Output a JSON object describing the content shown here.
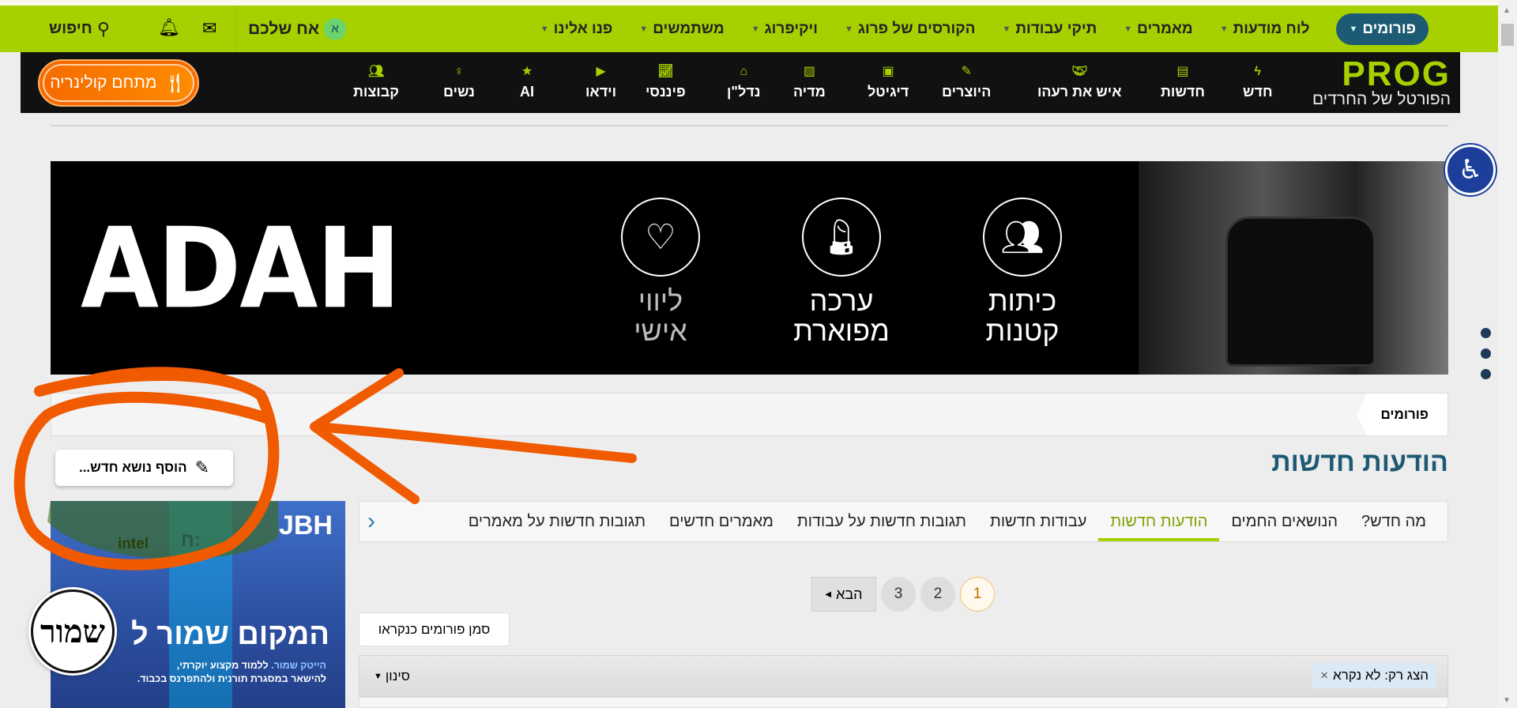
{
  "topnav": {
    "items": [
      {
        "label": "פורומים",
        "active": true
      },
      {
        "label": "לוח מודעות"
      },
      {
        "label": "מאמרים"
      },
      {
        "label": "תיקי עבודות"
      },
      {
        "label": "הקורסים של פרוג"
      },
      {
        "label": "ויקיפרוג"
      },
      {
        "label": "משתמשים"
      },
      {
        "label": "פנו אלינו"
      }
    ],
    "user_initial": "א",
    "user_name": "אח שלכם",
    "search_label": "חיפוש",
    "icons": [
      "envelope-icon",
      "bell-icon",
      "search-icon"
    ]
  },
  "logo": {
    "text": "PROG",
    "tagline": "הפורטל של החרדים"
  },
  "catnav": {
    "items": [
      {
        "label": "חדש",
        "icon": "bolt-icon"
      },
      {
        "label": "חדשות",
        "icon": "newspaper-icon"
      },
      {
        "label": "איש את רעהו",
        "icon": "handshake-icon"
      },
      {
        "label": "היוצרים",
        "icon": "brush-icon"
      },
      {
        "label": "דיגיטל",
        "icon": "monitor-icon"
      },
      {
        "label": "מדיה",
        "icon": "media-icon"
      },
      {
        "label": "נדל\"ן",
        "icon": "house-icon"
      },
      {
        "label": "פיננסי",
        "icon": "chart-icon"
      },
      {
        "label": "וידאו",
        "icon": "play-icon"
      },
      {
        "label": "AI",
        "icon": "stars-icon"
      },
      {
        "label": "נשים",
        "icon": "woman-icon"
      },
      {
        "label": "קבוצות",
        "icon": "group-icon"
      }
    ],
    "culinary_label": "מתחם קולינריה"
  },
  "banner": {
    "brand": "ADAH",
    "features": [
      {
        "line1": "כיתות",
        "line2": "קטנות"
      },
      {
        "line1": "ערכה",
        "line2": "מפוארת"
      },
      {
        "line1": "ליווי",
        "line2": "אישי"
      }
    ]
  },
  "breadcrumb": {
    "item": "פורומים"
  },
  "page": {
    "title": "הודעות חדשות",
    "add_topic": "הוסף נושא חדש...",
    "tabs": [
      "מה חדש?",
      "הנושאים החמים",
      "הודעות חדשות",
      "עבודות חדשות",
      "תגובות חדשות על עבודות",
      "מאמרים חדשים",
      "תגובות חדשות על מאמרים"
    ],
    "active_tab": 2,
    "pagination": {
      "pages": [
        "1",
        "2",
        "3"
      ],
      "current": "1",
      "next": "הבא"
    },
    "mark_read": "סמן פורומים כנקראו",
    "filter_chip": "הצג רק: לא נקרא",
    "filter_chip_close": "×",
    "filter_button": "סינון"
  },
  "side_ad": {
    "brand": "JBH",
    "logos": [
      "intel",
      "ח:"
    ],
    "headline": "המקום שמור ל",
    "sub_highlight": "הייטק שמור.",
    "sub_line1": " ללמוד מקצוע יוקרתי,",
    "sub_line2": "להישאר במסגרת תורנית ולהתפרנס בכבוד."
  },
  "badge": {
    "text": "שמור"
  },
  "colors": {
    "green": "#a6d000",
    "blue": "#1d5a73",
    "black": "#111111",
    "orange": "#f56a00",
    "annotation": "#f05a00"
  }
}
